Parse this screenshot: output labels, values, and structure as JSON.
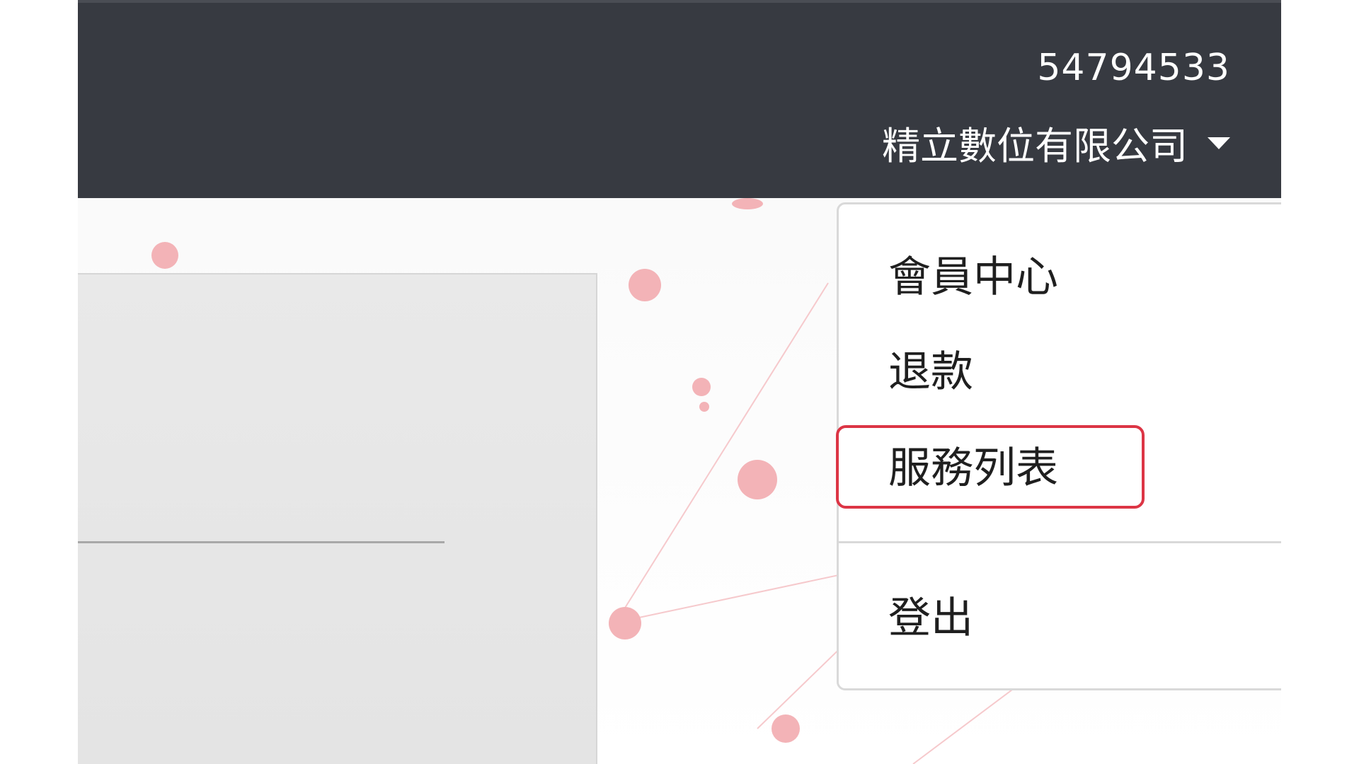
{
  "header": {
    "account_id": "54794533",
    "company_name": "精立數位有限公司",
    "dropdown_icon": "caret-down-icon"
  },
  "user_menu": {
    "items": [
      {
        "label": "會員中心"
      },
      {
        "label": "退款"
      },
      {
        "label": "服務列表",
        "highlighted": true
      },
      {
        "label": "登出"
      }
    ]
  },
  "colors": {
    "header_bg": "#373a41",
    "header_text": "#ffffff",
    "menu_text": "#1f1f1f",
    "menu_border": "#d9d9d9",
    "highlight": "#dc3545",
    "accent_dots": "#f3b3b7"
  }
}
